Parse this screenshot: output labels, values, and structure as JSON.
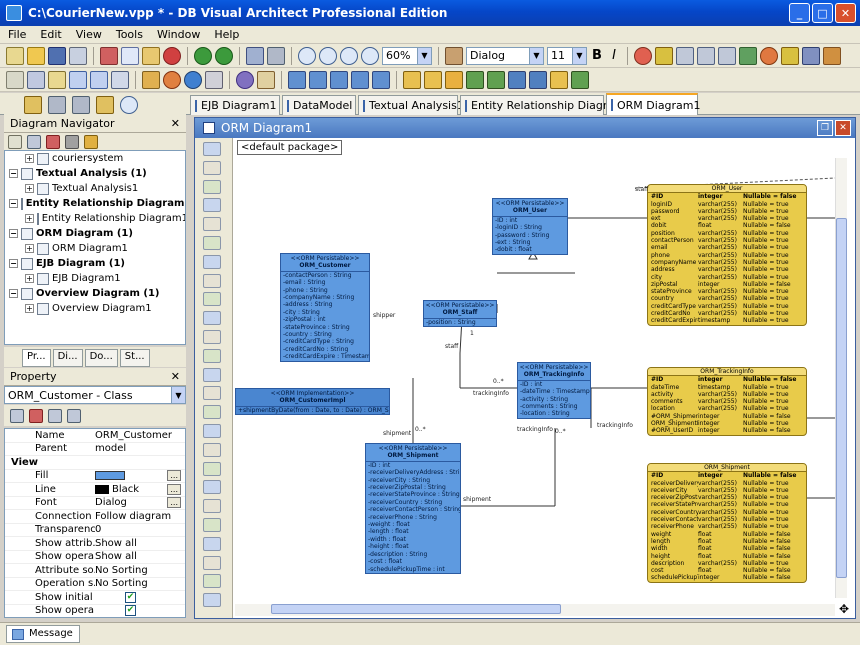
{
  "window": {
    "title": "C:\\CourierNew.vpp * - DB Visual Architect Professional Edition"
  },
  "menu": [
    "File",
    "Edit",
    "View",
    "Tools",
    "Window",
    "Help"
  ],
  "toolbar": {
    "zoom": "60%",
    "font": "Dialog",
    "font_size": "11",
    "bold": "B",
    "italic": "I"
  },
  "tabs": [
    "EJB Diagram1",
    "DataModel",
    "Textual Analysis1",
    "Entity Relationship Diagram1",
    "ORM Diagram1"
  ],
  "navigator": {
    "title": "Diagram Navigator",
    "items": [
      {
        "label": "couriersystem",
        "bold": false,
        "indent": 1
      },
      {
        "label": "Textual Analysis (1)",
        "bold": true,
        "indent": 0
      },
      {
        "label": "Textual Analysis1",
        "bold": false,
        "indent": 1
      },
      {
        "label": "Entity Relationship Diagram (",
        "bold": true,
        "indent": 0
      },
      {
        "label": "Entity Relationship Diagram1",
        "bold": false,
        "indent": 1
      },
      {
        "label": "ORM Diagram (1)",
        "bold": true,
        "indent": 0
      },
      {
        "label": "ORM Diagram1",
        "bold": false,
        "indent": 1
      },
      {
        "label": "EJB Diagram (1)",
        "bold": true,
        "indent": 0
      },
      {
        "label": "EJB Diagram1",
        "bold": false,
        "indent": 1
      },
      {
        "label": "Overview Diagram (1)",
        "bold": true,
        "indent": 0
      },
      {
        "label": "Overview Diagram1",
        "bold": false,
        "indent": 1
      }
    ]
  },
  "panel_tabs": [
    "Pr...",
    "Di...",
    "Do...",
    "St..."
  ],
  "property": {
    "title": "Property",
    "selected": "ORM_Customer - Class",
    "rows": [
      {
        "key": "Name",
        "value": "ORM_Customer"
      },
      {
        "key": "Parent",
        "value": "model"
      },
      {
        "key": "View",
        "value": ""
      },
      {
        "key": "Fill",
        "value": ""
      },
      {
        "key": "Line",
        "value": "Black"
      },
      {
        "key": "Font",
        "value": "Dialog"
      },
      {
        "key": "Connection ...",
        "value": "Follow diagram"
      },
      {
        "key": "Transparency",
        "value": "0"
      },
      {
        "key": "Show attrib...",
        "value": "Show all"
      },
      {
        "key": "Show opera...",
        "value": "Show all"
      },
      {
        "key": "Attribute so...",
        "value": "No Sorting"
      },
      {
        "key": "Operation s...",
        "value": "No Sorting"
      },
      {
        "key": "Show initial ...",
        "value": "✔"
      },
      {
        "key": "Show opera...",
        "value": "✔"
      }
    ]
  },
  "diagram": {
    "title": "ORM Diagram1",
    "package": "<default package>",
    "stereotype": "<<ORM Persistable>>",
    "classes": {
      "user": {
        "name": "ORM_User",
        "attrs": [
          "-ID : int",
          "-loginID : String",
          "-password : String",
          "-ext : String",
          "-dobit : float"
        ]
      },
      "customer": {
        "name": "ORM_Customer",
        "attrs": [
          "-contactPerson : String",
          "-email : String",
          "-phone : String",
          "-companyName : String",
          "-address : String",
          "-city : String",
          "-zipPostal : int",
          "-stateProvince : String",
          "-country : String",
          "-creditCardType : String",
          "-creditCardNo : String",
          "-creditCardExpire : Timestamp"
        ]
      },
      "staff": {
        "name": "ORM_Staff",
        "attrs": [
          "-position : String"
        ]
      },
      "tracking": {
        "name": "ORM_TrackingInfo",
        "attrs": [
          "-ID : int",
          "-dateTime : Timestamp",
          "-activity : String",
          "-comments : String",
          "-location : String"
        ]
      },
      "shipment": {
        "name": "ORM_Shipment",
        "attrs": [
          "-ID : int",
          "-receiverDeliveryAddress : String",
          "-receiverCity : String",
          "-receiverZipPostal : String",
          "-receiverStateProvince : String",
          "-receiverCountry : String",
          "-receiverContactPerson : String",
          "-receiverPhone : String",
          "-weight : float",
          "-length : float",
          "-width : float",
          "-height : float",
          "-description : String",
          "-cost : float",
          "-schedulePickupTime : int"
        ]
      },
      "impl": {
        "stereo": "<<ORM Implementation>>",
        "name": "ORM_CustomerImpl",
        "op": "+shipmentByDate(from : Date, to : Date) : ORM_Shipment[]"
      }
    },
    "labels": {
      "staff": "staff",
      "shipper": "shipper",
      "shipment": "shipment",
      "trackingInfo": "trackingInfo",
      "one": "1",
      "many": "0..*",
      "trackingInfo2": "trackingInfo"
    },
    "entities": {
      "user": {
        "name": "ORM_User",
        "header": [
          "#ID",
          "integer",
          "Nullable = false"
        ],
        "rows": [
          [
            "loginID",
            "varchar(255)",
            "Nullable = true"
          ],
          [
            "password",
            "varchar(255)",
            "Nullable = true"
          ],
          [
            "ext",
            "varchar(255)",
            "Nullable = true"
          ],
          [
            "dobit",
            "float",
            "Nullable = false"
          ],
          [
            "position",
            "varchar(255)",
            "Nullable = true"
          ],
          [
            "contactPerson",
            "varchar(255)",
            "Nullable = true"
          ],
          [
            "email",
            "varchar(255)",
            "Nullable = true"
          ],
          [
            "phone",
            "varchar(255)",
            "Nullable = true"
          ],
          [
            "companyName",
            "varchar(255)",
            "Nullable = true"
          ],
          [
            "address",
            "varchar(255)",
            "Nullable = true"
          ],
          [
            "city",
            "varchar(255)",
            "Nullable = true"
          ],
          [
            "zipPostal",
            "integer",
            "Nullable = false"
          ],
          [
            "stateProvince",
            "varchar(255)",
            "Nullable = true"
          ],
          [
            "country",
            "varchar(255)",
            "Nullable = true"
          ],
          [
            "creditCardType",
            "varchar(255)",
            "Nullable = true"
          ],
          [
            "creditCardNo",
            "varchar(255)",
            "Nullable = true"
          ],
          [
            "creditCardExpires",
            "timestamp",
            "Nullable = true"
          ]
        ]
      },
      "tracking": {
        "name": "ORM_TrackingInfo",
        "header": [
          "#ID",
          "integer",
          "Nullable = false"
        ],
        "rows": [
          [
            "dateTime",
            "timestamp",
            "Nullable = true"
          ],
          [
            "activity",
            "varchar(255)",
            "Nullable = true"
          ],
          [
            "comments",
            "varchar(255)",
            "Nullable = true"
          ],
          [
            "location",
            "varchar(255)",
            "Nullable = true"
          ],
          [
            "#ORM_ShipmentID",
            "integer",
            "Nullable = false"
          ],
          [
            "ORM_ShipmentIndex",
            "integer",
            "Nullable = true"
          ],
          [
            "#ORM_UserID",
            "integer",
            "Nullable = false"
          ]
        ]
      },
      "shipment": {
        "name": "ORM_Shipment",
        "header": [
          "#ID",
          "integer",
          "Nullable = false"
        ],
        "rows": [
          [
            "receiverDeliveryAddress",
            "varchar(255)",
            "Nullable = true"
          ],
          [
            "receiverCity",
            "varchar(255)",
            "Nullable = true"
          ],
          [
            "receiverZipPostal",
            "varchar(255)",
            "Nullable = true"
          ],
          [
            "receiverStateProvince",
            "varchar(255)",
            "Nullable = true"
          ],
          [
            "receiverCountry",
            "varchar(255)",
            "Nullable = true"
          ],
          [
            "receiverContactPerson",
            "varchar(255)",
            "Nullable = true"
          ],
          [
            "receiverPhone",
            "varchar(255)",
            "Nullable = true"
          ],
          [
            "weight",
            "float",
            "Nullable = false"
          ],
          [
            "length",
            "float",
            "Nullable = false"
          ],
          [
            "width",
            "float",
            "Nullable = false"
          ],
          [
            "height",
            "float",
            "Nullable = false"
          ],
          [
            "description",
            "varchar(255)",
            "Nullable = true"
          ],
          [
            "cost",
            "float",
            "Nullable = false"
          ],
          [
            "schedulePickupTime",
            "integer",
            "Nullable = false"
          ]
        ]
      }
    }
  },
  "status": {
    "message_tab": "Message"
  }
}
